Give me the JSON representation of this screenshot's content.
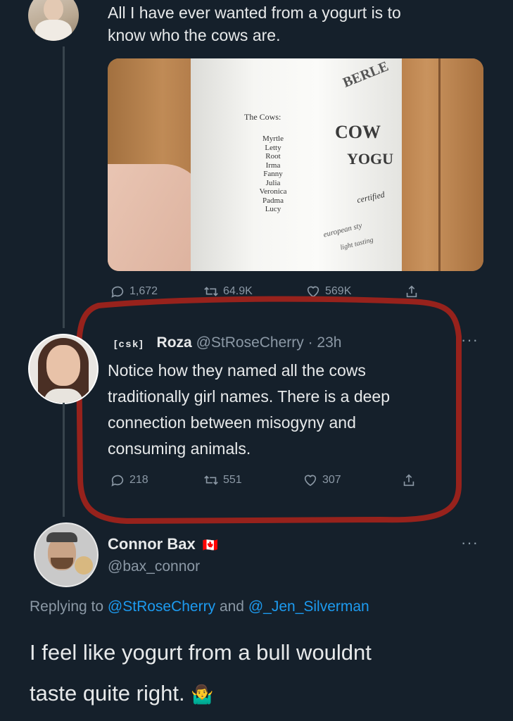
{
  "tweet1": {
    "text_line1": "All I have ever wanted from a yogurt is to",
    "text_line2": "know who the cows are.",
    "photo": {
      "brand": "BERLE",
      "title_line1": "COW",
      "title_line2": "YOGU",
      "list_heading": "The Cows:",
      "cows": [
        "Myrtle",
        "Letty",
        "Root",
        "Irma",
        "Fanny",
        "Julia",
        "Veronica",
        "Padma",
        "Lucy"
      ],
      "certified": "certified",
      "euro_line1": "european sty",
      "euro_line2": "light tasting"
    },
    "replies": "1,672",
    "retweets": "64.9K",
    "likes": "569K"
  },
  "tweet2": {
    "badge": "[csk]",
    "name": "Roza",
    "handle": "@StRoseCherry",
    "time": "· 23h",
    "lines": [
      "Notice how they named all the cows",
      "traditionally girl names. There is a deep",
      "connection between misogyny and",
      "consuming animals."
    ],
    "replies": "218",
    "retweets": "551",
    "likes": "307",
    "highlight_color": "#a3231b"
  },
  "tweet3": {
    "name": "Connor Bax",
    "flag": "🇨🇦",
    "handle": "@bax_connor",
    "replying_prefix": "Replying to",
    "mention1": "@StRoseCherry",
    "and": "and",
    "mention2": "@_Jen_Silverman",
    "line1": "I feel like yogurt from a bull wouldnt",
    "line2": "taste quite right.",
    "emoji": "🤷‍♂️"
  },
  "colors": {
    "background": "#15202b",
    "accent": "#1d9bf0",
    "muted": "#8b98a5"
  }
}
